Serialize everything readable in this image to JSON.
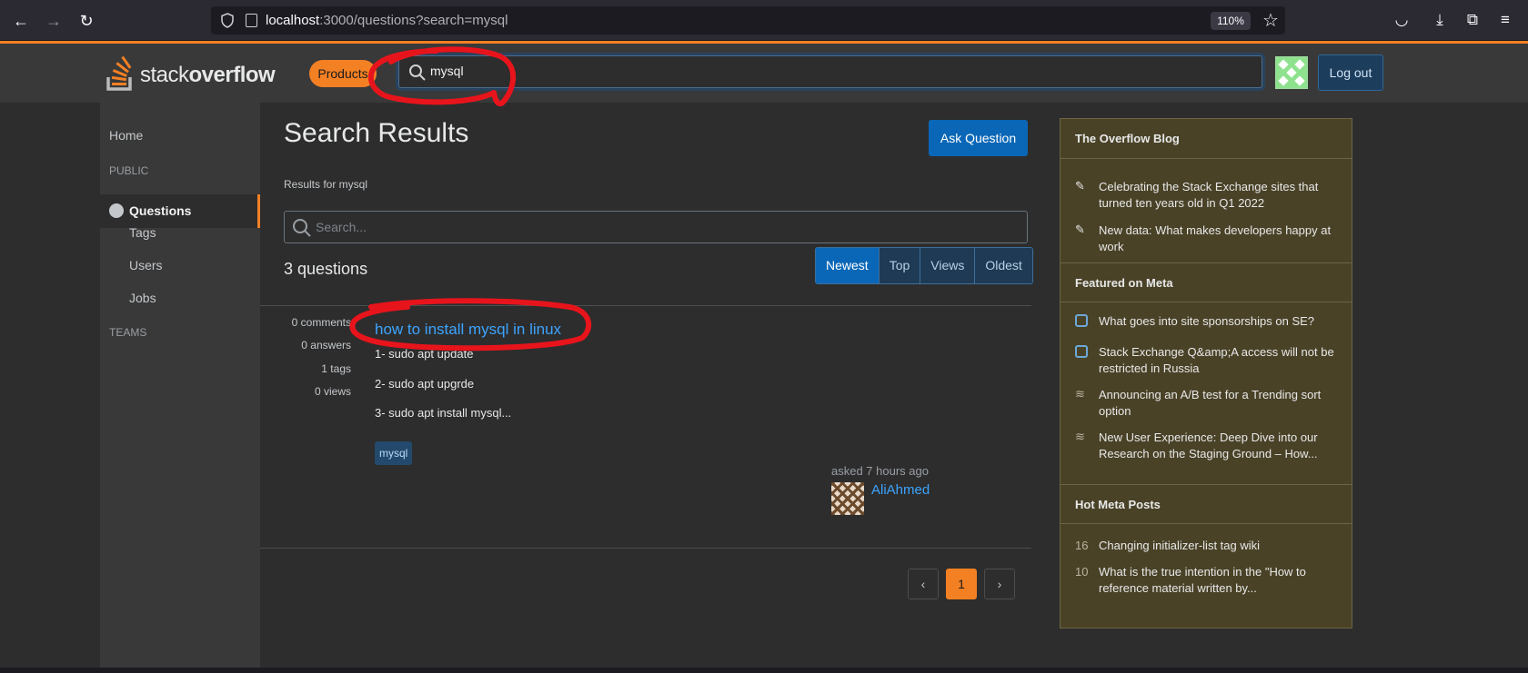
{
  "browser": {
    "url_host": "localhost",
    "url_rest": ":3000/questions?search=mysql",
    "zoom": "110%"
  },
  "header": {
    "logo_light": "stack",
    "logo_bold": "overflow",
    "products_label": "Products",
    "search_value": "mysql",
    "logout_label": "Log out"
  },
  "left_nav": {
    "home": "Home",
    "public_heading": "PUBLIC",
    "questions": "Questions",
    "tags": "Tags",
    "users": "Users",
    "jobs": "Jobs",
    "teams_heading": "TEAMS"
  },
  "main": {
    "title": "Search Results",
    "ask_button": "Ask Question",
    "results_for": "Results for mysql",
    "search_placeholder": "Search...",
    "question_count": "3 questions",
    "filters": [
      "Newest",
      "Top",
      "Views",
      "Oldest"
    ],
    "active_filter": "Newest"
  },
  "question": {
    "stats": {
      "comments": "0 comments",
      "answers": "0 answers",
      "tags": "1 tags",
      "views": "0 views"
    },
    "title": "how to install mysql in linux",
    "excerpt": [
      "1- sudo apt update",
      "2- sudo apt upgrde",
      "3- sudo apt install mysql..."
    ],
    "tag": "mysql",
    "asked": "asked 7 hours ago",
    "user": "AliAhmed"
  },
  "pagination": {
    "prev": "‹",
    "page": "1",
    "next": "›"
  },
  "sidebar": {
    "blog_heading": "The Overflow Blog",
    "blog_items": [
      "Celebrating the Stack Exchange sites that turned ten years old in Q1 2022",
      "New data: What makes developers happy at work"
    ],
    "meta_heading": "Featured on Meta",
    "meta_items": [
      "What goes into site sponsorships on SE?",
      "Stack Exchange Q&amp;A access will not be restricted in Russia",
      "Announcing an A/B test for a Trending sort option",
      "New User Experience: Deep Dive into our Research on the Staging Ground – How..."
    ],
    "hot_heading": "Hot Meta Posts",
    "hot_items": [
      {
        "count": "16",
        "text": "Changing initializer-list tag wiki"
      },
      {
        "count": "10",
        "text": "What is the true intention in the \"How to reference material written by..."
      }
    ]
  },
  "colors": {
    "accent": "#f48024",
    "link": "#3ca4ff",
    "primary_button": "#0a67b7",
    "annotation": "#e8141c"
  }
}
